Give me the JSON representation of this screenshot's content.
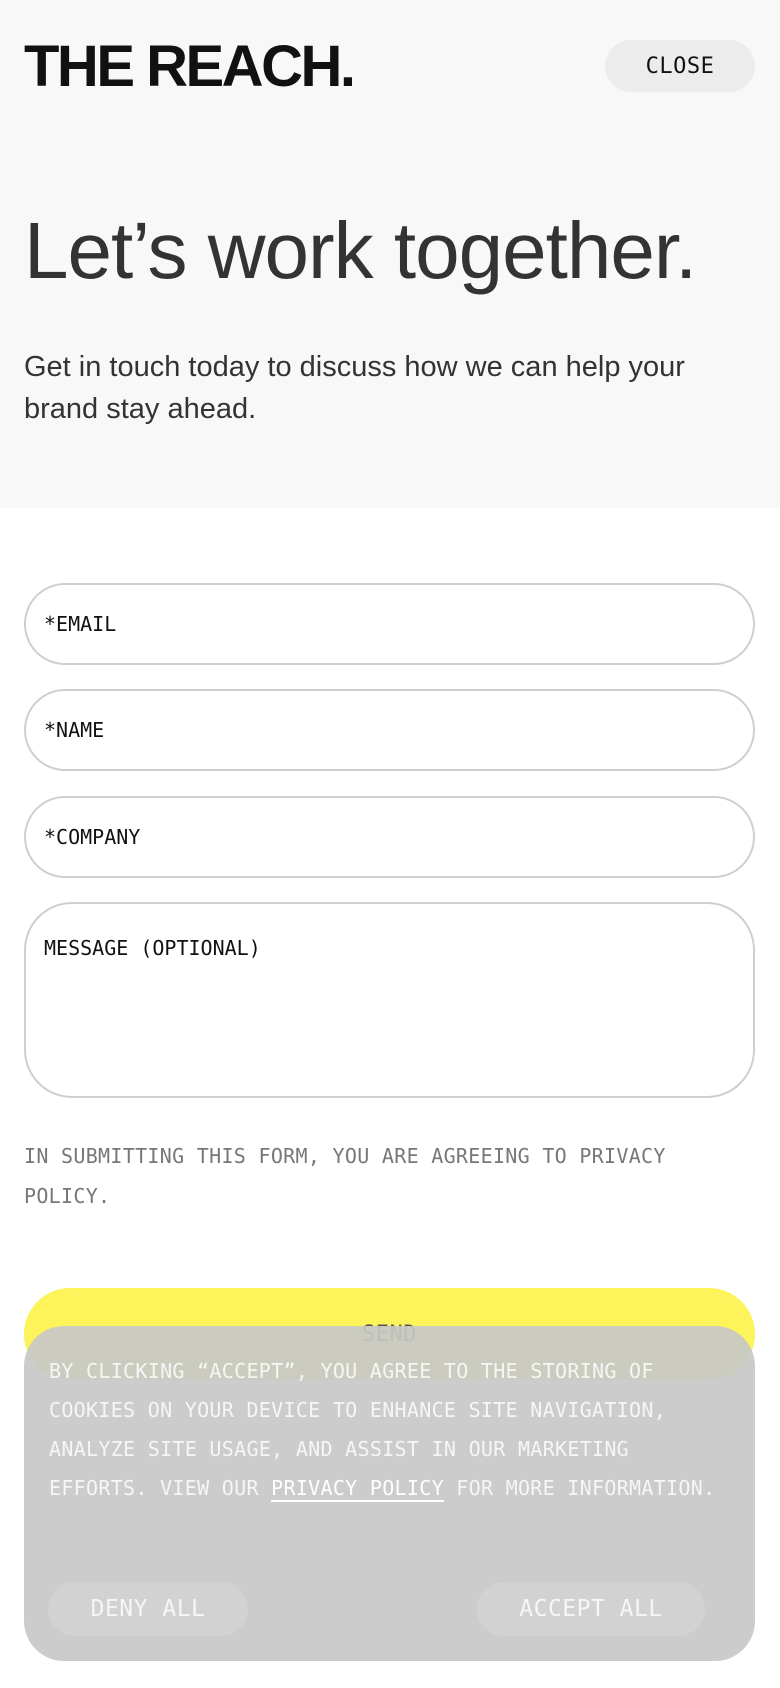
{
  "header": {
    "logo": "THE REACH.",
    "close_label": "CLOSE"
  },
  "hero": {
    "headline": "Let’s work together.",
    "subhead": "Get in touch today to discuss how we can help your brand stay ahead."
  },
  "form": {
    "email_placeholder": "*EMAIL",
    "name_placeholder": "*NAME",
    "company_placeholder": "*COMPANY",
    "message_placeholder": "MESSAGE (OPTIONAL)",
    "consent_text": "IN SUBMITTING THIS FORM, YOU ARE AGREEING TO PRIVACY POLICY.",
    "send_label": "SEND"
  },
  "cookie_banner": {
    "text_before_link": "BY CLICKING “ACCEPT”, YOU AGREE TO THE STORING OF COOKIES ON YOUR DEVICE TO ENHANCE SITE NAVIGATION, ANALYZE SITE USAGE, AND ASSIST IN OUR MARKETING EFFORTS. VIEW OUR ",
    "link_text": "PRIVACY POLICY",
    "text_after_link": " FOR MORE INFORMATION.",
    "deny_label": "DENY ALL",
    "accept_label": "ACCEPT ALL"
  },
  "colors": {
    "hero_background": "#f8f8f8",
    "send_button": "#fdf35a",
    "cookie_background": "#c8c8c8"
  }
}
